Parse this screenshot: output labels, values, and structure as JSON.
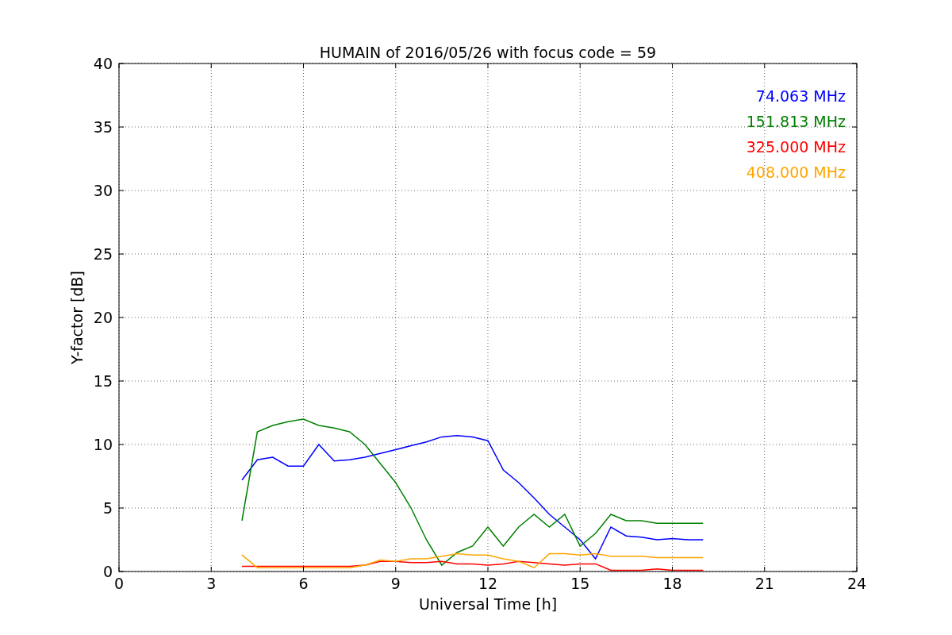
{
  "chart": {
    "chart_data": {
      "type": "line",
      "title": "HUMAIN of 2016/05/26 with focus code = 59",
      "xlabel": "Universal Time [h]",
      "ylabel": "Y-factor [dB]",
      "x": [
        4,
        4.5,
        5,
        5.5,
        6,
        6.5,
        7,
        7.5,
        8,
        8.5,
        9,
        9.5,
        10,
        10.5,
        11,
        11.5,
        12,
        12.5,
        13,
        13.5,
        14,
        14.5,
        15,
        15.5,
        16,
        16.5,
        17,
        17.5,
        18,
        18.5,
        19
      ],
      "series": [
        {
          "name": "74.063 MHz",
          "color": "#0000ff",
          "values": [
            7.2,
            8.8,
            9.0,
            8.3,
            8.3,
            10.0,
            8.7,
            8.8,
            9.0,
            9.3,
            9.6,
            9.9,
            10.2,
            10.6,
            10.7,
            10.6,
            10.3,
            8.0,
            7.0,
            5.8,
            4.5,
            3.5,
            2.5,
            1.0,
            3.5,
            2.8,
            2.7,
            2.5,
            2.6,
            2.5,
            2.5
          ]
        },
        {
          "name": "151.813 MHz",
          "color": "#008000",
          "values": [
            4.0,
            11.0,
            11.5,
            11.8,
            12.0,
            11.5,
            11.3,
            11.0,
            10.0,
            8.5,
            7.0,
            5.0,
            2.5,
            0.5,
            1.5,
            2.0,
            3.5,
            2.0,
            3.5,
            4.5,
            3.5,
            4.5,
            2.0,
            3.0,
            4.5,
            4.0,
            4.0,
            3.8,
            3.8,
            3.8,
            3.8
          ]
        },
        {
          "name": "325.000 MHz",
          "color": "#ff0000",
          "values": [
            0.4,
            0.4,
            0.4,
            0.4,
            0.4,
            0.4,
            0.4,
            0.4,
            0.5,
            0.8,
            0.8,
            0.7,
            0.7,
            0.8,
            0.6,
            0.6,
            0.5,
            0.6,
            0.8,
            0.7,
            0.6,
            0.5,
            0.6,
            0.6,
            0.1,
            0.1,
            0.1,
            0.2,
            0.1,
            0.1,
            0.1
          ]
        },
        {
          "name": "408.000 MHz",
          "color": "#ffa500",
          "values": [
            1.3,
            0.3,
            0.3,
            0.3,
            0.3,
            0.3,
            0.3,
            0.3,
            0.5,
            0.9,
            0.8,
            1.0,
            1.0,
            1.2,
            1.4,
            1.3,
            1.3,
            1.0,
            0.8,
            0.3,
            1.4,
            1.4,
            1.3,
            1.4,
            1.2,
            1.2,
            1.2,
            1.1,
            1.1,
            1.1,
            1.1
          ]
        }
      ],
      "grid": true,
      "xlim": [
        0,
        24
      ],
      "ylim": [
        0,
        40
      ],
      "xticks": [
        0,
        3,
        6,
        9,
        12,
        15,
        18,
        21,
        24
      ],
      "yticks": [
        0,
        5,
        10,
        15,
        20,
        25,
        30,
        35,
        40
      ]
    }
  }
}
